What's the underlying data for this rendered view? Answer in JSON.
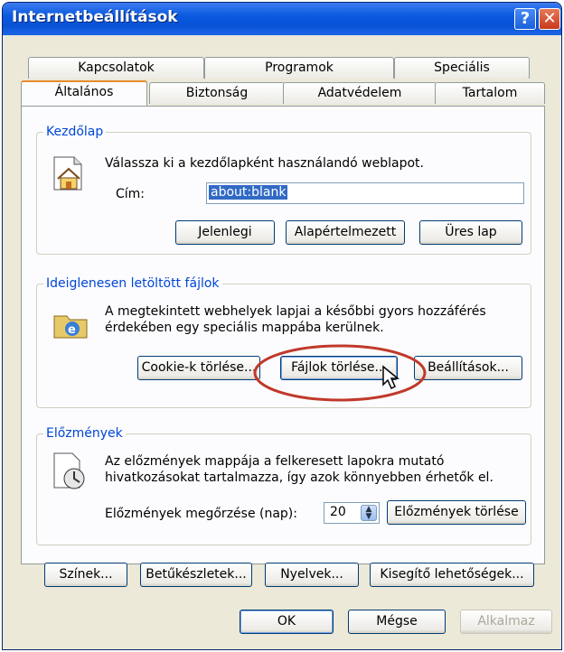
{
  "window": {
    "title": "Internetbeállítások",
    "help_label": "?",
    "close_label": "✕"
  },
  "tabs": {
    "row_back": [
      "Kapcsolatok",
      "Programok",
      "Speciális"
    ],
    "row_front": [
      "Általános",
      "Biztonság",
      "Adatvédelem",
      "Tartalom"
    ],
    "active": "Általános"
  },
  "home": {
    "legend": "Kezdőlap",
    "description": "Válassza ki a kezdőlapként használandó weblapot.",
    "address_label": "Cím:",
    "address_value": "about:blank",
    "btn_current": "Jelenlegi",
    "btn_default": "Alapértelmezett",
    "btn_blank": "Üres lap"
  },
  "temp_files": {
    "legend": "Ideiglenesen letöltött fájlok",
    "description_1": "A megtekintett webhelyek lapjai a későbbi gyors hozzáférés",
    "description_2": "érdekében egy speciális mappába kerülnek.",
    "btn_cookies": "Cookie-k törlése...",
    "btn_files": "Fájlok törlése...",
    "btn_settings": "Beállítások..."
  },
  "history": {
    "legend": "Előzmények",
    "description_1": "Az előzmények mappája a felkeresett lapokra mutató",
    "description_2": "hivatkozásokat tartalmazza, így azok könnyebben érhetők el.",
    "days_label": "Előzmények megőrzése (nap):",
    "days_value": "20",
    "btn_clear": "Előzmények törlése"
  },
  "bottom_buttons": {
    "colors": "Színek...",
    "fonts": "Betűkészletek...",
    "languages": "Nyelvek...",
    "accessibility": "Kisegítő lehetőségek..."
  },
  "dialog_buttons": {
    "ok": "OK",
    "cancel": "Mégse",
    "apply": "Alkalmaz"
  },
  "colors": {
    "highlight_circle": "#c0392b",
    "title_bar": "#0a5ae0",
    "selection": "#316ac5"
  }
}
